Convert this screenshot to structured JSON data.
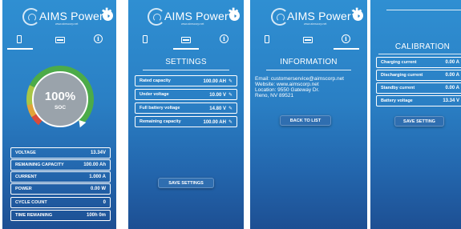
{
  "brand": {
    "name": "AIMS Power",
    "trademark": "™",
    "website_small": "www.aimscorp.net"
  },
  "tabs": [
    {
      "name": "dashboard",
      "icon": "phone-icon"
    },
    {
      "name": "settings",
      "icon": "card-icon"
    },
    {
      "name": "information",
      "icon": "info-icon"
    }
  ],
  "dashboard": {
    "soc_percent": "100%",
    "soc_label": "SOC",
    "soc_value": 100,
    "rows": [
      {
        "label": "VOLTAGE",
        "value": "13.34V"
      },
      {
        "label": "REMAINING CAPACITY",
        "value": "100.00 Ah"
      },
      {
        "label": "CURRENT",
        "value": "1.000 A"
      },
      {
        "label": "POWER",
        "value": "0.00 W"
      },
      {
        "label": "CYCLE COUNT",
        "value": "0"
      },
      {
        "label": "TIME REMAINING",
        "value": "100h 0m"
      }
    ]
  },
  "settings": {
    "title": "SETTINGS",
    "rows": [
      {
        "label": "Rated capacity",
        "value": "100.00 AH"
      },
      {
        "label": "Under voltage",
        "value": "10.00 V"
      },
      {
        "label": "Full battery voltage",
        "value": "14.80 V"
      },
      {
        "label": "Remaining capacity",
        "value": "100.00 AH"
      }
    ],
    "save_button": "SAVE SETTINGS"
  },
  "information": {
    "title": "INFORMATION",
    "lines": [
      "Email: customerservice@aimscorp.net",
      "Website: www.aimscorp.net",
      "Location: 9550 Gateway Dr.",
      "Reno, NV 89521"
    ],
    "back_button": "BACK TO LIST"
  },
  "calibration": {
    "title": "CALIBRATION",
    "rows": [
      {
        "label": "Charging current",
        "value": "0.00 A"
      },
      {
        "label": "Discharging current",
        "value": "0.00 A"
      },
      {
        "label": "Standby current",
        "value": "0.00 A"
      },
      {
        "label": "Battery voltage",
        "value": "13.34 V"
      }
    ],
    "save_button": "SAVE SETTING"
  },
  "colors": {
    "bg_top": "#2f8fd2",
    "bg_bottom": "#1d4f93",
    "gauge_green": "#4cab49",
    "gauge_red": "#d94b3b",
    "gauge_inner": "#9aa3ab"
  }
}
